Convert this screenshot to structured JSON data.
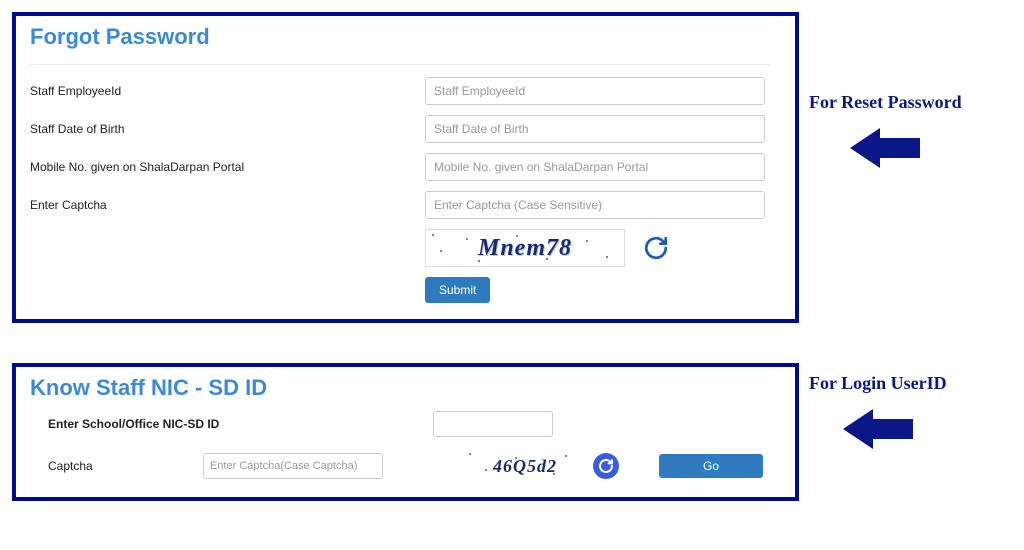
{
  "panel1": {
    "title": "Forgot Password",
    "fields": {
      "emp": {
        "label": "Staff EmployeeId",
        "placeholder": "Staff EmployeeId"
      },
      "dob": {
        "label": "Staff Date of Birth",
        "placeholder": "Staff Date of Birth"
      },
      "mobile": {
        "label": "Mobile No. given on ShalaDarpan Portal",
        "placeholder": "Mobile No. given on ShalaDarpan Portal"
      },
      "captcha": {
        "label": "Enter Captcha",
        "placeholder": "Enter Captcha (Case Sensitive)"
      }
    },
    "captcha_value": "Mnem78",
    "submit_label": "Submit"
  },
  "panel2": {
    "title": "Know Staff NIC - SD ID",
    "field_school": {
      "label": "Enter School/Office NIC-SD ID"
    },
    "field_captcha": {
      "label": "Captcha",
      "placeholder": "Enter Captcha(Case Captcha)"
    },
    "captcha_value": "46Q5d2",
    "go_label": "Go"
  },
  "annotations": {
    "reset": "For Reset Password",
    "login": "For Login UserID"
  }
}
